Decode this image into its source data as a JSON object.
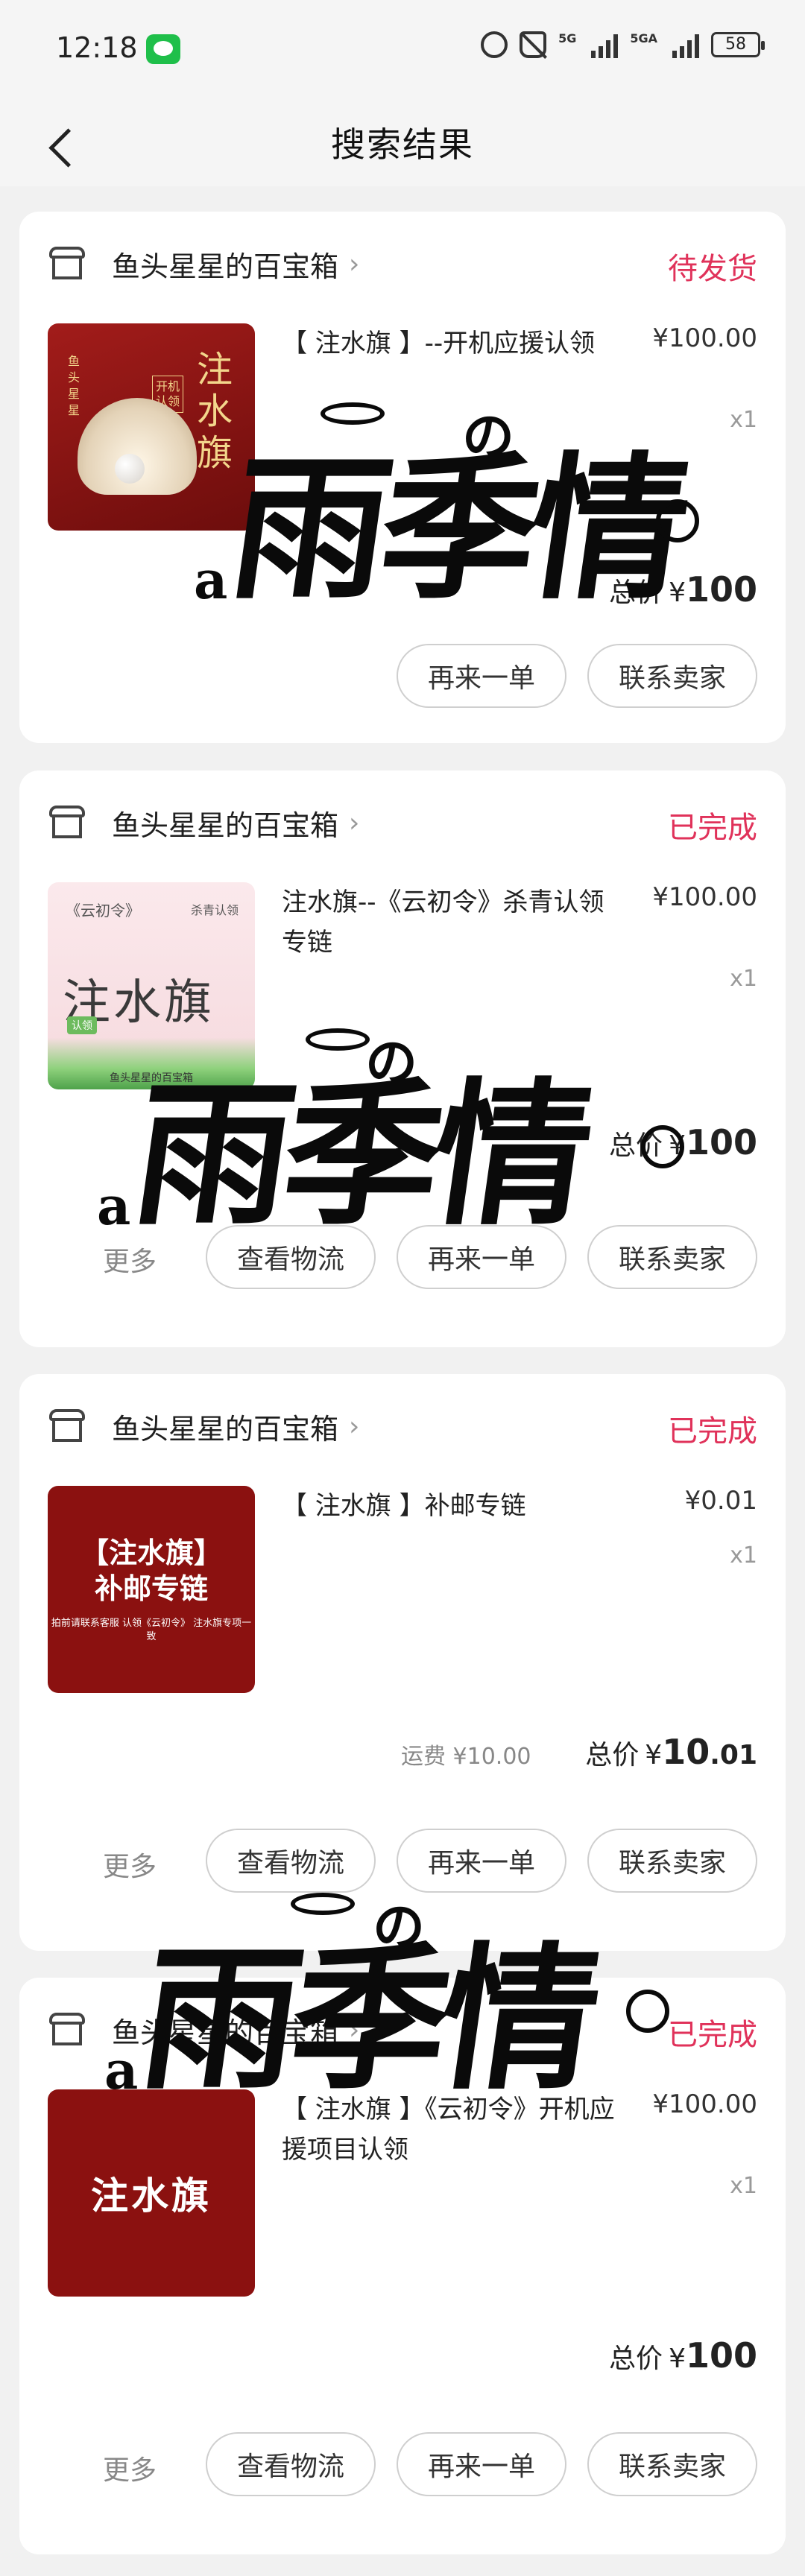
{
  "status_bar": {
    "time": "12:18",
    "network_1": "5G",
    "network_2": "5GA",
    "battery": "58"
  },
  "header": {
    "title": "搜索结果"
  },
  "actions": {
    "more": "更多",
    "logistics": "查看物流",
    "reorder": "再来一单",
    "contact": "联系卖家"
  },
  "total_label": "总价",
  "currency": "¥",
  "watermark_text": "雨季情",
  "watermark_a": "a",
  "watermark_no": "の",
  "orders": [
    {
      "shop": "鱼头星星的百宝箱",
      "status": "待发货",
      "title": "【 注水旗 】--开机应援认领",
      "price": "¥100.00",
      "qty": "x1",
      "total_int": "100",
      "total_dec": "",
      "thumb": {
        "title": "注水旗",
        "side": "鱼头星星",
        "small": "开机认领"
      }
    },
    {
      "shop": "鱼头星星的百宝箱",
      "status": "已完成",
      "title": "注水旗--《云初令》杀青认领专链",
      "price": "¥100.00",
      "qty": "x1",
      "total_int": "100",
      "total_dec": "",
      "thumb": {
        "top_left": "《云初令》",
        "top_right": "杀青认领",
        "title": "注水旗",
        "badge": "认领",
        "bottom": "鱼头星星的百宝箱"
      }
    },
    {
      "shop": "鱼头星星的百宝箱",
      "status": "已完成",
      "title": "【 注水旗 】补邮专链",
      "price": "¥0.01",
      "qty": "x1",
      "shipping": "运费 ¥10.00",
      "total_int": "10",
      "total_dec": ".01",
      "thumb": {
        "title": "【注水旗】",
        "sub": "补邮专链",
        "small": "拍前请联系客服 认领《云初令》 注水旗专项一致"
      }
    },
    {
      "shop": "鱼头星星的百宝箱",
      "status": "已完成",
      "title": "【 注水旗 】《云初令》开机应援项目认领",
      "price": "¥100.00",
      "qty": "x1",
      "total_int": "100",
      "total_dec": "",
      "thumb": {
        "title": "注水旗"
      }
    }
  ]
}
